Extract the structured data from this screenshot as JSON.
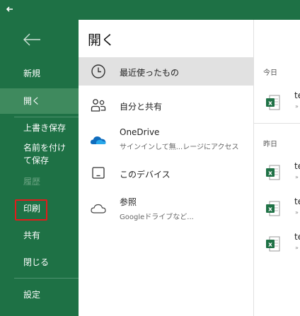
{
  "sidebar": {
    "items": [
      {
        "label": "新規",
        "state": "normal"
      },
      {
        "label": "開く",
        "state": "active"
      },
      {
        "label": "上書き保存",
        "state": "normal"
      },
      {
        "label": "名前を付けて保存",
        "state": "normal"
      },
      {
        "label": "履歴",
        "state": "disabled"
      },
      {
        "label": "印刷",
        "state": "highlighted"
      },
      {
        "label": "共有",
        "state": "normal"
      },
      {
        "label": "閉じる",
        "state": "normal"
      },
      {
        "label": "設定",
        "state": "normal"
      }
    ]
  },
  "main": {
    "title": "開く",
    "locations": [
      {
        "label": "最近使ったもの",
        "icon": "clock-icon",
        "selected": true
      },
      {
        "label": "自分と共有",
        "icon": "people-icon"
      },
      {
        "label": "OneDrive",
        "sublabel": "サインインして無...レージにアクセス",
        "icon": "onedrive-cloud-icon"
      },
      {
        "label": "このデバイス",
        "icon": "device-icon"
      },
      {
        "label": "参照",
        "sublabel": "Googleドライブなど...",
        "icon": "cloud-outline-icon"
      }
    ]
  },
  "recent": {
    "today_label": "今日",
    "yesterday_label": "昨日",
    "files": [
      {
        "name": "te",
        "sub": "»",
        "icon": "excel-file-icon"
      },
      {
        "name": "te",
        "sub": "»",
        "icon": "excel-file-icon"
      },
      {
        "name": "te",
        "sub": "»",
        "icon": "excel-file-icon"
      },
      {
        "name": "te",
        "sub": "»",
        "icon": "excel-file-icon"
      }
    ]
  },
  "colors": {
    "brand_green": "#1e7145",
    "sidebar_active": "#3f8a5e",
    "highlight_red": "#e31b1b",
    "selected_row": "#e1e1e1",
    "onedrive_blue": "#0f6cbd"
  }
}
